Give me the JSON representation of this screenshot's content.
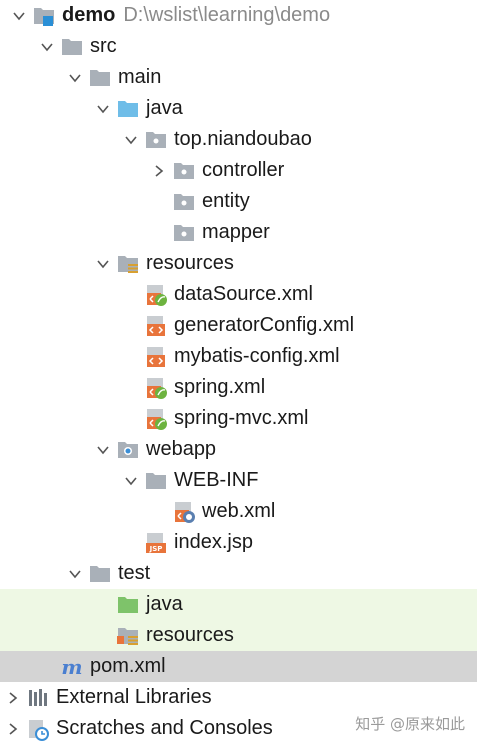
{
  "project": {
    "name": "demo",
    "path": "D:\\wslist\\learning\\demo"
  },
  "tree": {
    "src": "src",
    "main": "main",
    "java": "java",
    "package": "top.niandoubao",
    "controller": "controller",
    "entity": "entity",
    "mapper": "mapper",
    "resources": "resources",
    "files": [
      "dataSource.xml",
      "generatorConfig.xml",
      "mybatis-config.xml",
      "spring.xml",
      "spring-mvc.xml"
    ],
    "webapp": "webapp",
    "webinf": "WEB-INF",
    "webxml": "web.xml",
    "indexjsp": "index.jsp",
    "test": "test",
    "test_java": "java",
    "test_resources": "resources",
    "pom": "pom.xml",
    "external_libraries": "External Libraries",
    "scratches": "Scratches and Consoles"
  },
  "watermark": "知乎 @原来如此",
  "colors": {
    "folder": "#a9b0b8",
    "source_folder": "#6fbde8",
    "test_folder": "#7ec36a",
    "xml_orange": "#e8743b",
    "spring_green": "#6db33f",
    "selected_bg": "#d4d4d4",
    "test_bg": "#eef8e4"
  }
}
